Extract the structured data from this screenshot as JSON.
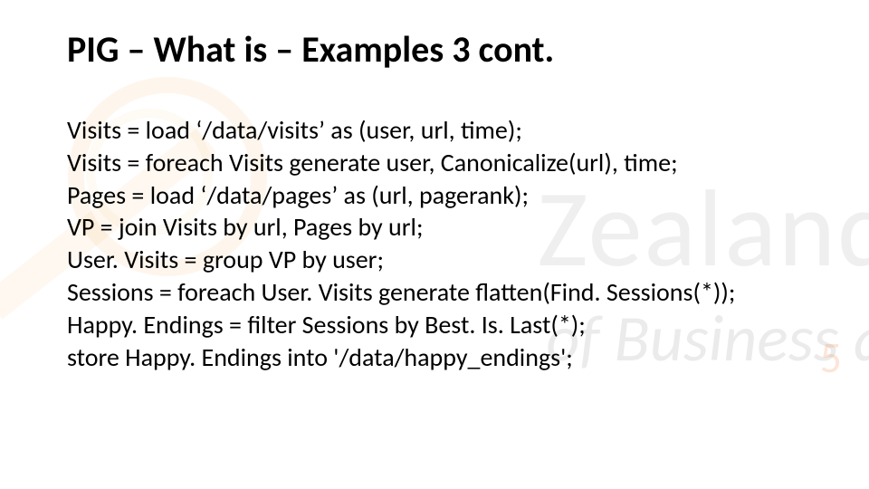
{
  "title": "PIG – What is – Examples 3 cont.",
  "watermark": {
    "line1": "Zealand",
    "line2": "of Business a",
    "number": "5"
  },
  "code": {
    "l1": "Visits = load ‘/data/visits’ as (user, url, time);",
    "l2": "Visits = foreach Visits generate user, Canonicalize(url), time;",
    "l3": "Pages = load ‘/data/pages’ as (url, pagerank);",
    "l4": "VP = join Visits by url, Pages by url;",
    "l5": "User. Visits = group VP by user;",
    "l6": "Sessions = foreach User. Visits generate flatten(Find. Sessions(*));",
    "l7": "Happy. Endings = filter Sessions by Best. Is. Last(*);",
    "l8": "store Happy. Endings into '/data/happy_endings';"
  }
}
